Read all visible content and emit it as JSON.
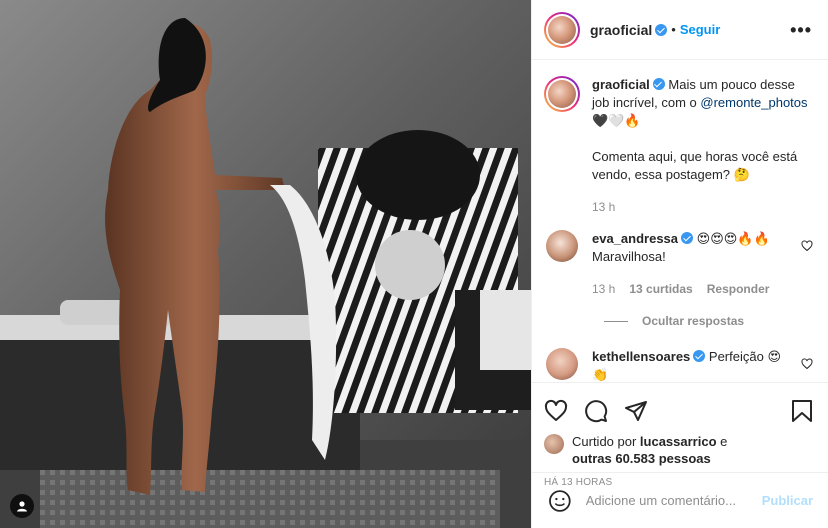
{
  "post": {
    "username": "graoficial",
    "follow_label": "Seguir",
    "separator": "•",
    "more_label": "•••"
  },
  "caption": {
    "username": "graoficial",
    "text_part1": "Mais um pouco desse job incrível, com o ",
    "mention": "@remonte_photos",
    "emojis": "🖤🤍🔥",
    "text_part2": "Comenta aqui, que horas você está vendo, essa postagem? 🤔",
    "time": "13 h"
  },
  "comments": [
    {
      "username": "eva_andressa",
      "text": "😍😍😍🔥🔥",
      "text_line2": "Maravilhosa!",
      "time": "13 h",
      "likes": "13 curtidas",
      "reply_label": "Responder"
    },
    {
      "username": "kethellensoares",
      "text": "Perfeição 😍",
      "text_line2": "👏"
    }
  ],
  "hide_replies_label": "Ocultar respostas",
  "likes": {
    "prefix": "Curtido por ",
    "user": "lucassarrico",
    "conjunction": " e",
    "others": "outras 60.583 pessoas"
  },
  "time_ago": "HÁ 13 HORAS",
  "comment_input": {
    "placeholder": "Adicione um comentário...",
    "publish_label": "Publicar"
  },
  "icons": [
    "heart-icon",
    "comment-icon",
    "share-icon",
    "bookmark-icon",
    "emoji-icon",
    "user-tag-icon"
  ],
  "colors": {
    "link_blue": "#0095f6",
    "mention_blue": "#00376b",
    "verified_blue": "#3897f0",
    "muted_gray": "#8e8e8e",
    "publish_disabled": "#b2dffc"
  }
}
